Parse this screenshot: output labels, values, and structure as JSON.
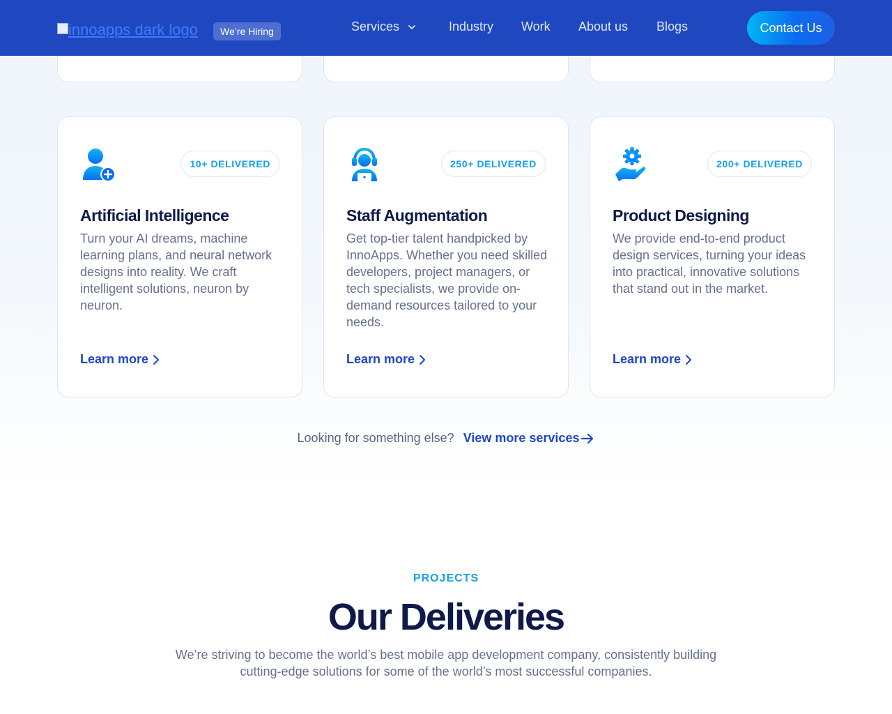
{
  "header": {
    "logo_alt": "innoapps dark logo",
    "hiring_badge": "We’re Hiring",
    "nav": [
      {
        "label": "Services",
        "has_dropdown": true
      },
      {
        "label": "Industry"
      },
      {
        "label": "Work"
      },
      {
        "label": "About us"
      },
      {
        "label": "Blogs"
      }
    ],
    "contact_button": "Contact Us"
  },
  "services": [
    {
      "icon": "user-plus-icon",
      "badge": "10+ DELIVERED",
      "title": "Artificial Intelligence",
      "description": "Turn your AI dreams, machine learning plans, and neural network designs into reality. We craft intelligent solutions, neuron by neuron.",
      "link": "Learn more"
    },
    {
      "icon": "support-agent-icon",
      "badge": "250+ DELIVERED",
      "title": "Staff Augmentation",
      "description": "Get top-tier talent handpicked by InnoApps. Whether you need skilled developers, project managers, or tech specialists, we provide on-demand resources tailored to your needs.",
      "link": "Learn more"
    },
    {
      "icon": "hand-gear-icon",
      "badge": "200+ DELIVERED",
      "title": "Product Designing",
      "description": "We provide end-to-end product design services, turning your ideas into practical, innovative solutions that stand out in the market.",
      "link": "Learn more"
    }
  ],
  "more": {
    "question": "Looking for something else?",
    "link": "View more services"
  },
  "projects": {
    "eyebrow": "PROJECTS",
    "title": "Our Deliveries",
    "subtitle": "We’re striving to become the world’s best mobile app development company, consistently building cutting-edge solutions for some of the world’s most successful companies."
  },
  "colors": {
    "header_bg": "#1f47c0",
    "accent_blue": "#1d46c8",
    "badge_cyan": "#12a0ea",
    "heading_navy": "#0f1a4a"
  }
}
